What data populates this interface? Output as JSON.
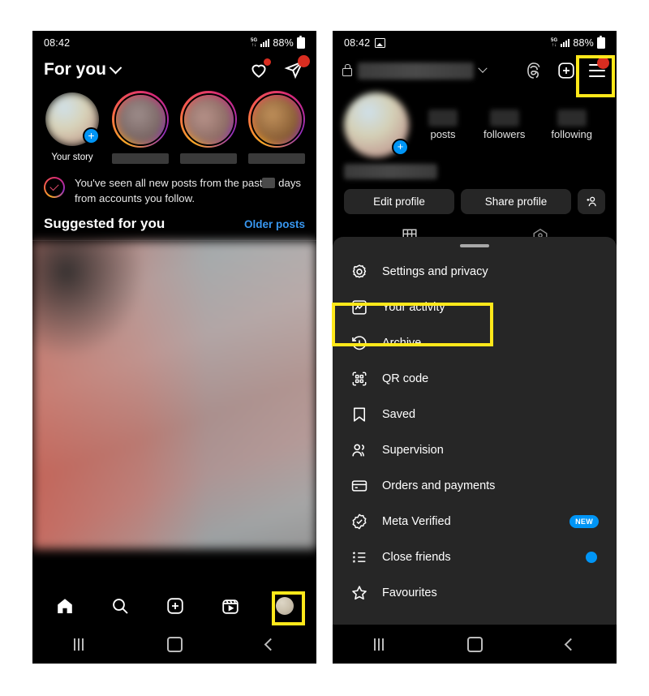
{
  "left_phone": {
    "status_bar": {
      "time": "08:42",
      "network": "5G",
      "battery_pct": "88%"
    },
    "header": {
      "title": "For you",
      "chevron_icon": "chevron-down-icon",
      "like_icon": "heart-icon",
      "messages_icon": "direct-message-icon",
      "has_like_badge": true,
      "has_message_badge": true
    },
    "stories": [
      {
        "label": "Your story",
        "redacted": false,
        "has_add": true,
        "ring": false
      },
      {
        "label": "",
        "redacted": true,
        "has_add": false,
        "ring": true
      },
      {
        "label": "",
        "redacted": true,
        "has_add": false,
        "ring": true
      },
      {
        "label": "",
        "redacted": true,
        "has_add": false,
        "ring": true
      }
    ],
    "caught_up": {
      "text_before": "You've seen all new posts from the past",
      "redacted_value": "",
      "text_after": "days",
      "text_line2": "from accounts you follow.",
      "icon": "check-circle-icon"
    },
    "suggested": {
      "title": "Suggested for you",
      "link": "Older posts"
    },
    "tabbar": [
      {
        "name": "home",
        "icon": "home-icon"
      },
      {
        "name": "search",
        "icon": "search-icon"
      },
      {
        "name": "create",
        "icon": "plus-square-icon"
      },
      {
        "name": "reels",
        "icon": "reels-icon"
      },
      {
        "name": "profile",
        "icon": "profile-avatar-icon"
      }
    ],
    "android_nav": [
      {
        "name": "recents",
        "icon": "recents-icon"
      },
      {
        "name": "home",
        "icon": "android-home-icon"
      },
      {
        "name": "back",
        "icon": "back-icon"
      }
    ]
  },
  "right_phone": {
    "status_bar": {
      "time": "08:42",
      "network": "5G",
      "battery_pct": "88%",
      "screenshot_icon": "image-icon"
    },
    "header": {
      "lock_icon": "lock-icon",
      "username": "",
      "username_redacted": true,
      "chevron_icon": "chevron-down-icon",
      "threads_icon": "threads-icon",
      "add_icon": "plus-square-icon",
      "menu_icon": "hamburger-menu-icon",
      "has_menu_badge": true
    },
    "profile": {
      "avatar_add_icon": "plus-badge-icon",
      "stats": [
        {
          "label": "posts",
          "value": "",
          "redacted": true
        },
        {
          "label": "followers",
          "value": "",
          "redacted": true
        },
        {
          "label": "following",
          "value": "",
          "redacted": true
        }
      ],
      "display_name": "",
      "buttons": [
        {
          "label": "Edit profile"
        },
        {
          "label": "Share profile"
        }
      ],
      "add_person_icon": "add-person-icon",
      "tabs": [
        {
          "name": "grid",
          "icon": "grid-icon"
        },
        {
          "name": "tagged",
          "icon": "tagged-icon"
        }
      ]
    },
    "sheet": {
      "grabber": "drag-handle",
      "items": [
        {
          "label": "Settings and privacy",
          "icon": "settings-gear-icon",
          "badge": null
        },
        {
          "label": "Your activity",
          "icon": "activity-chart-icon",
          "badge": null
        },
        {
          "label": "Archive",
          "icon": "archive-clock-icon",
          "badge": null
        },
        {
          "label": "QR code",
          "icon": "qr-code-icon",
          "badge": null
        },
        {
          "label": "Saved",
          "icon": "bookmark-icon",
          "badge": null
        },
        {
          "label": "Supervision",
          "icon": "supervision-people-icon",
          "badge": null
        },
        {
          "label": "Orders and payments",
          "icon": "credit-card-icon",
          "badge": null
        },
        {
          "label": "Meta Verified",
          "icon": "verified-badge-icon",
          "badge": "NEW"
        },
        {
          "label": "Close friends",
          "icon": "close-friends-list-icon",
          "badge": "dot"
        },
        {
          "label": "Favourites",
          "icon": "star-icon",
          "badge": null
        }
      ]
    },
    "android_nav": [
      {
        "name": "recents",
        "icon": "recents-icon"
      },
      {
        "name": "home",
        "icon": "android-home-icon"
      },
      {
        "name": "back",
        "icon": "back-icon"
      }
    ]
  },
  "highlights": {
    "color": "#ffe81a",
    "targets": [
      "hamburger-menu-icon",
      "Your activity",
      "profile-avatar-tab"
    ]
  }
}
